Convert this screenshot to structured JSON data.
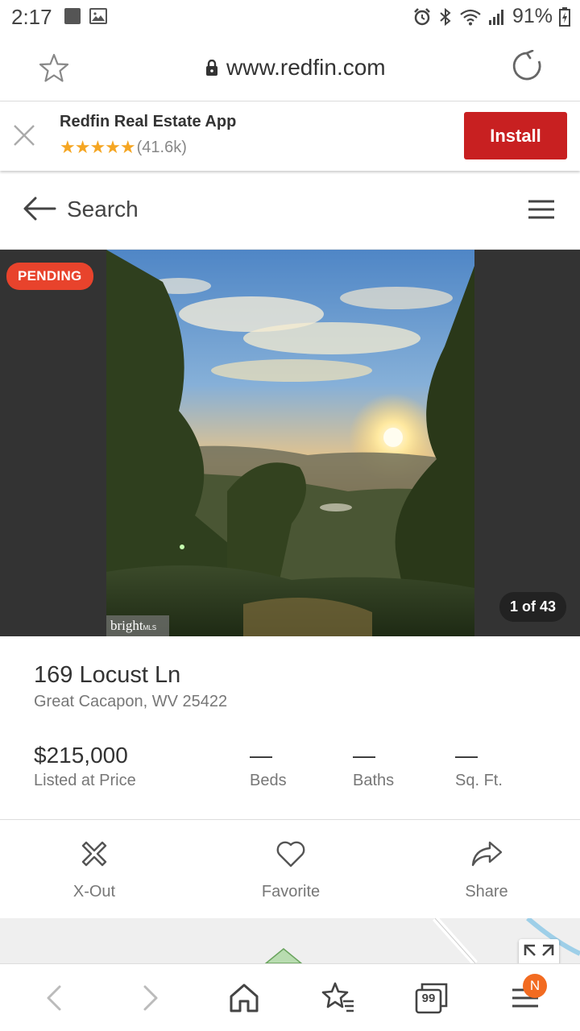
{
  "status_bar": {
    "time": "2:17",
    "battery": "91%"
  },
  "browser": {
    "url": "www.redfin.com"
  },
  "app_banner": {
    "title": "Redfin Real Estate App",
    "rating_count": "(41.6k)",
    "stars": "★★★★★",
    "install_label": "Install",
    "accent_color": "#c82021"
  },
  "header": {
    "search_label": "Search"
  },
  "photo": {
    "status_badge": "PENDING",
    "counter": "1 of 43",
    "watermark": "bright",
    "watermark_sub": "MLS"
  },
  "listing": {
    "address": "169 Locust Ln",
    "city_state_zip": "Great Cacapon, WV 25422",
    "price": "$215,000",
    "price_label": "Listed at Price",
    "beds_value": "—",
    "beds_label": "Beds",
    "baths_value": "—",
    "baths_label": "Baths",
    "sqft_value": "—",
    "sqft_label": "Sq. Ft."
  },
  "actions": {
    "xout_label": "X-Out",
    "favorite_label": "Favorite",
    "share_label": "Share"
  },
  "bottom_nav": {
    "tab_count": "99",
    "notif_letter": "N"
  }
}
